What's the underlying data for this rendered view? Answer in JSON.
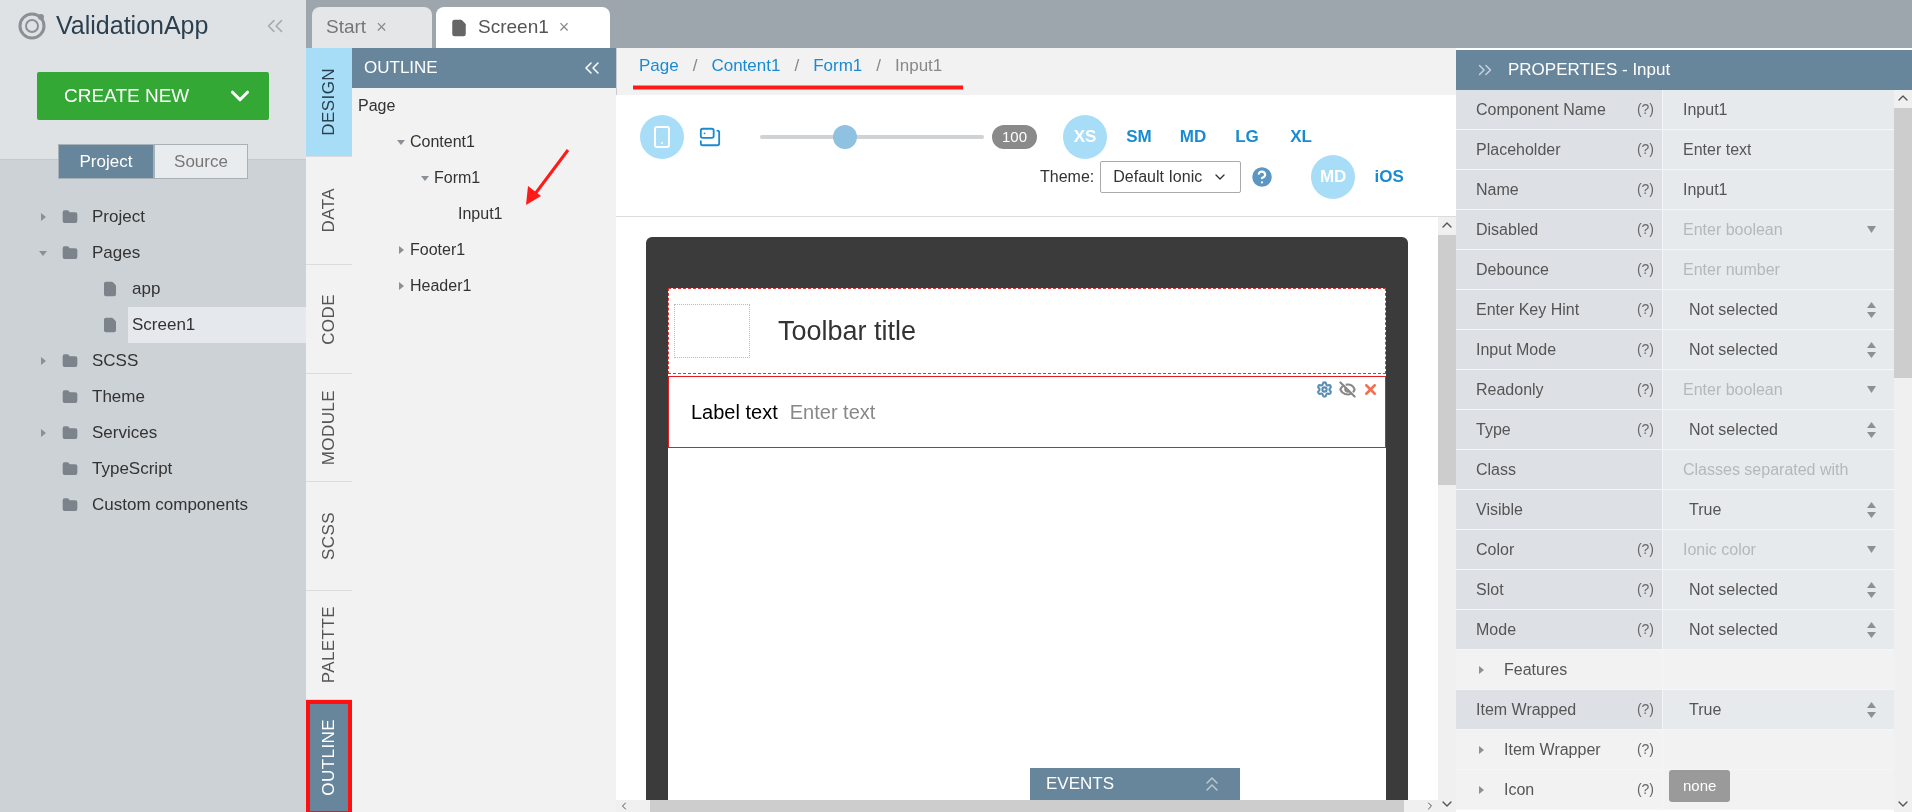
{
  "app": {
    "title": "ValidationApp",
    "create_button": "CREATE NEW",
    "source_tabs": [
      {
        "label": "Project",
        "selected": true
      },
      {
        "label": "Source",
        "selected": false
      }
    ]
  },
  "project_tree": [
    {
      "label": "Project",
      "kind": "folder",
      "expanded": false
    },
    {
      "label": "Pages",
      "kind": "folder",
      "expanded": true,
      "children": [
        {
          "label": "app",
          "kind": "file",
          "selected": false
        },
        {
          "label": "Screen1",
          "kind": "file",
          "selected": true
        }
      ]
    },
    {
      "label": "SCSS",
      "kind": "folder",
      "expanded": false
    },
    {
      "label": "Theme",
      "kind": "folder"
    },
    {
      "label": "Services",
      "kind": "folder",
      "expanded": false
    },
    {
      "label": "TypeScript",
      "kind": "folder"
    },
    {
      "label": "Custom components",
      "kind": "folder"
    }
  ],
  "editor_tabs": [
    {
      "label": "Start",
      "selected": false,
      "close": "×"
    },
    {
      "label": "Screen1",
      "selected": true,
      "close": "×"
    }
  ],
  "view_tabs": [
    {
      "label": "DESIGN",
      "selected": true
    },
    {
      "label": "DATA",
      "selected": false
    },
    {
      "label": "CODE",
      "selected": false
    },
    {
      "label": "MODULE",
      "selected": false
    },
    {
      "label": "SCSS",
      "selected": false
    }
  ],
  "panel_tabs": [
    {
      "label": "PALETTE",
      "selected": false
    },
    {
      "label": "OUTLINE",
      "selected": true
    }
  ],
  "outline": {
    "title": "OUTLINE",
    "tree": [
      {
        "label": "Page",
        "children": [
          {
            "label": "Content1",
            "expanded": true,
            "children": [
              {
                "label": "Form1",
                "expanded": true,
                "children": [
                  {
                    "label": "Input1"
                  }
                ]
              }
            ]
          },
          {
            "label": "Footer1",
            "expanded": false
          },
          {
            "label": "Header1",
            "expanded": false
          }
        ]
      }
    ]
  },
  "breadcrumb": [
    {
      "label": "Page",
      "link": true
    },
    {
      "sep": "/",
      "label": "Content1",
      "link": true
    },
    {
      "sep": "/",
      "label": "Form1",
      "link": true
    },
    {
      "sep": "/",
      "label": "Input1",
      "link": false
    }
  ],
  "toolbar": {
    "devices": [
      {
        "kind": "phone",
        "selected": true
      },
      {
        "kind": "tablet",
        "selected": false
      }
    ],
    "zoom": {
      "level": 0.38,
      "reading": "100"
    },
    "breakpoints": [
      {
        "label": "XS",
        "selected": true
      },
      {
        "label": "SM",
        "selected": false
      },
      {
        "label": "MD",
        "selected": false
      },
      {
        "label": "LG",
        "selected": false
      },
      {
        "label": "XL",
        "selected": false
      }
    ],
    "theme_label": "Theme:",
    "theme_value": "Default Ionic",
    "modes": [
      {
        "label": "MD",
        "selected": true
      },
      {
        "label": "iOS",
        "selected": false
      }
    ]
  },
  "canvas": {
    "toolbar_title": "Toolbar title",
    "input_label": "Label text",
    "input_placeholder": "Enter text",
    "events": "EVENTS"
  },
  "properties": {
    "title": "PROPERTIES - Input",
    "rows": [
      {
        "label": "Component Name",
        "help": "(?)",
        "value": "Input1",
        "kind": "field"
      },
      {
        "label": "Placeholder",
        "help": "(?)",
        "value": "Enter text",
        "kind": "field"
      },
      {
        "label": "Name",
        "help": "(?)",
        "value": "Input1",
        "kind": "field"
      },
      {
        "label": "Disabled",
        "help": "(?)",
        "placeholder": "Enter boolean",
        "kind": "dropdown"
      },
      {
        "label": "Debounce",
        "help": "(?)",
        "placeholder": "Enter number",
        "kind": "field"
      },
      {
        "label": "Enter Key Hint",
        "help": "(?)",
        "value": "Not selected",
        "kind": "select"
      },
      {
        "label": "Input Mode",
        "help": "(?)",
        "value": "Not selected",
        "kind": "select"
      },
      {
        "label": "Readonly",
        "help": "(?)",
        "placeholder": "Enter boolean",
        "kind": "dropdown"
      },
      {
        "label": "Type",
        "help": "(?)",
        "value": "Not selected",
        "kind": "select"
      },
      {
        "label": "Class",
        "placeholder": "Classes separated with",
        "kind": "field"
      },
      {
        "label": "Visible",
        "value": "True",
        "kind": "select"
      },
      {
        "label": "Color",
        "help": "(?)",
        "placeholder": "Ionic color",
        "kind": "dropdown"
      },
      {
        "label": "Slot",
        "help": "(?)",
        "value": "Not selected",
        "kind": "select"
      },
      {
        "label": "Mode",
        "help": "(?)",
        "value": "Not selected",
        "kind": "select"
      },
      {
        "label": "Features",
        "kind": "section",
        "expanded": false
      },
      {
        "label": "Item Wrapped",
        "help": "(?)",
        "value": "True",
        "kind": "select"
      },
      {
        "label": "Item Wrapper",
        "help": "(?)",
        "kind": "section",
        "expanded": false
      },
      {
        "label": "Icon",
        "help": "(?)",
        "value": "none",
        "kind": "section",
        "expanded": false
      }
    ]
  }
}
